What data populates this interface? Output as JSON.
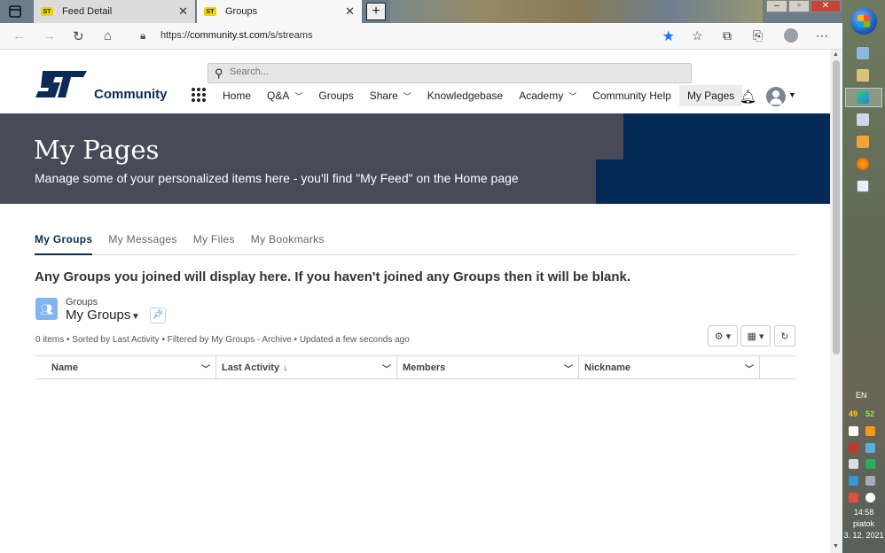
{
  "browser": {
    "tabs": [
      {
        "label": "Feed Detail",
        "favicon": "ST",
        "active": false
      },
      {
        "label": "Groups",
        "favicon": "ST",
        "active": true
      }
    ],
    "new_tab_label": "+",
    "url_prefix": "https://",
    "url_host": "community.st.com",
    "url_path": "/s/streams",
    "icons": [
      "back-icon",
      "forward-icon",
      "refresh-icon",
      "home-icon",
      "lock-icon",
      "favorite-star-icon",
      "favorites-icon",
      "collections-icon",
      "profile-icon",
      "menu-icon"
    ]
  },
  "site": {
    "brand": "Community",
    "search_placeholder": "Search...",
    "nav": [
      {
        "label": "Home",
        "dropdown": false
      },
      {
        "label": "Q&A",
        "dropdown": true
      },
      {
        "label": "Groups",
        "dropdown": false
      },
      {
        "label": "Share",
        "dropdown": true
      },
      {
        "label": "Knowledgebase",
        "dropdown": false
      },
      {
        "label": "Academy",
        "dropdown": true
      },
      {
        "label": "Community Help",
        "dropdown": false
      },
      {
        "label": "My Pages",
        "dropdown": false,
        "active": true
      }
    ]
  },
  "banner": {
    "title": "My Pages",
    "subtitle": "Manage some of your personalized items here - you'll find \"My Feed\" on the Home page"
  },
  "page_tabs": [
    {
      "label": "My Groups",
      "active": true
    },
    {
      "label": "My Messages",
      "active": false
    },
    {
      "label": "My Files",
      "active": false
    },
    {
      "label": "My Bookmarks",
      "active": false
    }
  ],
  "notice": "Any Groups you joined will display here. If you haven't joined any Groups then it will be blank.",
  "list_view": {
    "object_label": "Groups",
    "name": "My Groups",
    "info": "0 items • Sorted by Last Activity • Filtered by My Groups - Archive • Updated a few seconds ago",
    "columns": [
      {
        "label": "Name",
        "sorted": false
      },
      {
        "label": "Last Activity",
        "sorted": true,
        "sort_glyph": "↓"
      },
      {
        "label": "Members",
        "sorted": false
      },
      {
        "label": "Nickname",
        "sorted": false
      }
    ]
  },
  "taskbar": {
    "language": "EN",
    "tray_left": "49",
    "tray_right": "52",
    "time": "14:58",
    "day": "piatok",
    "date": "3. 12. 2021"
  },
  "colors": {
    "banner_gray": "#484a57",
    "banner_blue": "#032957",
    "brand_navy": "#0b2a56",
    "tab_yellow": "#f3d200"
  }
}
